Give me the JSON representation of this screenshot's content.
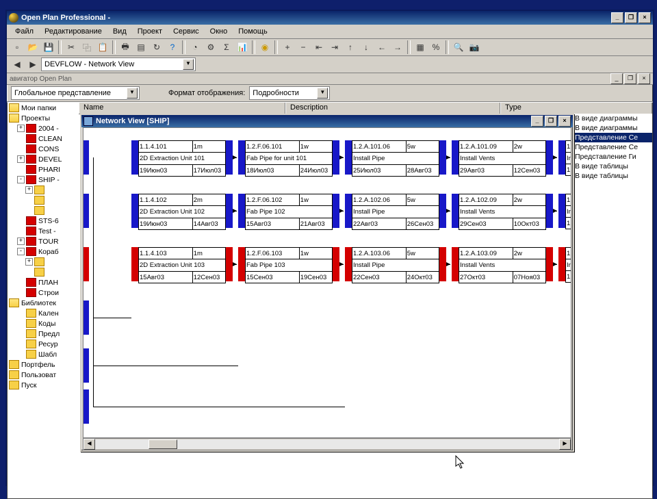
{
  "app_title": "Open Plan Professional -",
  "menu": [
    "Файл",
    "Редактирование",
    "Вид",
    "Проект",
    "Сервис",
    "Окно",
    "Помощь"
  ],
  "combo_main": "DEVFLOW - Network View",
  "panel_title": "авигатор Open Plan",
  "view_combo": "Глобальное представление",
  "format_label": "Формат отображения:",
  "format_value": "Подробности",
  "list_headers": {
    "name": "Name",
    "desc": "Description",
    "type": "Type"
  },
  "tree": [
    {
      "lvl": 0,
      "ic": "open",
      "t": "Мои папки"
    },
    {
      "lvl": 0,
      "ic": "open",
      "t": "Проекты"
    },
    {
      "lvl": 1,
      "tw": "+",
      "ic": "red",
      "t": "2004 -"
    },
    {
      "lvl": 1,
      "tw": "",
      "ic": "red",
      "t": "CLEAN"
    },
    {
      "lvl": 1,
      "tw": "",
      "ic": "red",
      "t": "CONS"
    },
    {
      "lvl": 1,
      "tw": "+",
      "ic": "red",
      "t": "DEVEL"
    },
    {
      "lvl": 1,
      "tw": "",
      "ic": "red",
      "t": "PHARI"
    },
    {
      "lvl": 1,
      "tw": "-",
      "ic": "red",
      "t": "SHIP -"
    },
    {
      "lvl": 2,
      "tw": "+",
      "ic": "f",
      "t": ""
    },
    {
      "lvl": 2,
      "tw": "",
      "ic": "f",
      "t": ""
    },
    {
      "lvl": 2,
      "tw": "",
      "ic": "f",
      "t": ""
    },
    {
      "lvl": 1,
      "tw": "",
      "ic": "red",
      "t": "STS-6"
    },
    {
      "lvl": 1,
      "tw": "",
      "ic": "red",
      "t": "Test -"
    },
    {
      "lvl": 1,
      "tw": "+",
      "ic": "red",
      "t": "TOUR"
    },
    {
      "lvl": 1,
      "tw": "-",
      "ic": "red",
      "t": "Кораб"
    },
    {
      "lvl": 2,
      "tw": "+",
      "ic": "f",
      "t": ""
    },
    {
      "lvl": 2,
      "tw": "",
      "ic": "f",
      "t": ""
    },
    {
      "lvl": 1,
      "tw": "",
      "ic": "red",
      "t": "ПЛАН"
    },
    {
      "lvl": 1,
      "tw": "",
      "ic": "red",
      "t": "Строи"
    },
    {
      "lvl": 0,
      "ic": "open",
      "t": "Библиотек"
    },
    {
      "lvl": 1,
      "tw": "",
      "ic": "f",
      "t": "Кален"
    },
    {
      "lvl": 1,
      "tw": "",
      "ic": "f",
      "t": "Коды"
    },
    {
      "lvl": 1,
      "tw": "",
      "ic": "f",
      "t": "Предл"
    },
    {
      "lvl": 1,
      "tw": "",
      "ic": "f",
      "t": "Ресур"
    },
    {
      "lvl": 1,
      "tw": "",
      "ic": "f",
      "t": "Шабл"
    },
    {
      "lvl": 0,
      "ic": "f",
      "t": "Портфель"
    },
    {
      "lvl": 0,
      "ic": "f",
      "t": "Пользоват"
    },
    {
      "lvl": 0,
      "ic": "f",
      "t": "Пуск"
    }
  ],
  "right_list": [
    "В виде диаграммы",
    "В виде диаграммы",
    "Представление Се",
    "Представление Се",
    "Представление Ги",
    "В виде таблицы",
    "В виде таблицы"
  ],
  "nv_title": "Network View [SHIP]",
  "nodes": [
    {
      "row": 0,
      "col": 0,
      "color": "blue",
      "id": "1.1.4.101",
      "dur": "1m",
      "desc": "2D Extraction Unit 101",
      "d1": "19Июн03",
      "d2": "17Июл03"
    },
    {
      "row": 0,
      "col": 1,
      "color": "blue",
      "id": "1.2.F.06.101",
      "dur": "1w",
      "desc": "Fab Pipe for unit 101",
      "d1": "18Июл03",
      "d2": "24Июл03"
    },
    {
      "row": 0,
      "col": 2,
      "color": "blue",
      "id": "1.2.A.101.06",
      "dur": "5w",
      "desc": "Install Pipe",
      "d1": "25Июл03",
      "d2": "28Авг03"
    },
    {
      "row": 0,
      "col": 3,
      "color": "blue",
      "id": "1.2.A.101.09",
      "dur": "2w",
      "desc": "Install Vents",
      "d1": "29Авг03",
      "d2": "12Сен03"
    },
    {
      "row": 1,
      "col": 0,
      "color": "blue",
      "id": "1.1.4.102",
      "dur": "2m",
      "desc": "2D Extraction Unit 102",
      "d1": "19Июн03",
      "d2": "14Авг03"
    },
    {
      "row": 1,
      "col": 1,
      "color": "blue",
      "id": "1.2.F.06.102",
      "dur": "1w",
      "desc": "Fab Pipe 102",
      "d1": "15Авг03",
      "d2": "21Авг03"
    },
    {
      "row": 1,
      "col": 2,
      "color": "blue",
      "id": "1.2.A.102.06",
      "dur": "5w",
      "desc": "Install Pipe",
      "d1": "22Авг03",
      "d2": "26Сен03"
    },
    {
      "row": 1,
      "col": 3,
      "color": "blue",
      "id": "1.2.A.102.09",
      "dur": "2w",
      "desc": "Install Vents",
      "d1": "29Сен03",
      "d2": "10Окт03"
    },
    {
      "row": 2,
      "col": 0,
      "color": "red",
      "id": "1.1.4.103",
      "dur": "1m",
      "desc": "2D Extraction Unit 103",
      "d1": "15Авг03",
      "d2": "12Сен03"
    },
    {
      "row": 2,
      "col": 1,
      "color": "red",
      "id": "1.2.F.06.103",
      "dur": "1w",
      "desc": "Fab Pipe 103",
      "d1": "15Сен03",
      "d2": "19Сен03"
    },
    {
      "row": 2,
      "col": 2,
      "color": "red",
      "id": "1.2.A.103.06",
      "dur": "5w",
      "desc": "Install Pipe",
      "d1": "22Сен03",
      "d2": "24Окт03"
    },
    {
      "row": 2,
      "col": 3,
      "color": "red",
      "id": "1.2.A.103.09",
      "dur": "2w",
      "desc": "Install Vents",
      "d1": "27Окт03",
      "d2": "07Ноя03"
    }
  ]
}
